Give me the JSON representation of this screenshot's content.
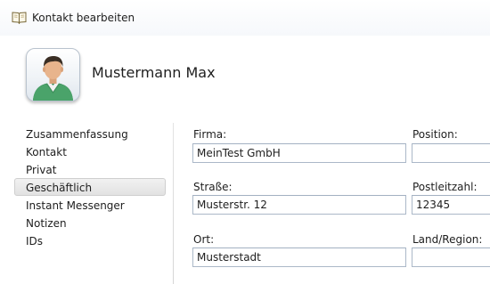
{
  "window": {
    "title": "Kontakt bearbeiten",
    "icon": "address-book-icon"
  },
  "contact": {
    "name": "Mustermann Max",
    "avatar": "person-avatar-icon"
  },
  "nav": {
    "items": [
      {
        "label": "Zusammenfassung"
      },
      {
        "label": "Kontakt"
      },
      {
        "label": "Privat"
      },
      {
        "label": "Geschäftlich",
        "selected": true
      },
      {
        "label": "Instant Messenger"
      },
      {
        "label": "Notizen"
      },
      {
        "label": "IDs"
      }
    ]
  },
  "form": {
    "firma": {
      "label": "Firma:",
      "value": "MeinTest GmbH"
    },
    "position": {
      "label": "Position:",
      "value": ""
    },
    "strasse": {
      "label": "Straße:",
      "value": "Musterstr. 12"
    },
    "plz": {
      "label": "Postleitzahl:",
      "value": "12345"
    },
    "ort": {
      "label": "Ort:",
      "value": "Musterstadt"
    },
    "region": {
      "label": "Land/Region:",
      "value": ""
    }
  },
  "colors": {
    "input_border": "#abb8c8",
    "selected_bg": "#e6e6e6"
  }
}
